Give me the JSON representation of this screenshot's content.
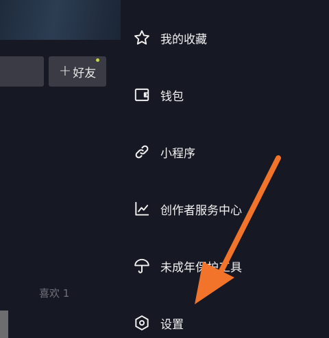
{
  "profile": {
    "add_friend_label": "好友",
    "add_friend_plus": "+",
    "likes_label": "喜欢 1"
  },
  "drawer": {
    "items": [
      {
        "label": "我的收藏",
        "icon": "star-icon"
      },
      {
        "label": "钱包",
        "icon": "wallet-icon"
      },
      {
        "label": "小程序",
        "icon": "link-icon"
      },
      {
        "label": "创作者服务中心",
        "icon": "chart-icon"
      },
      {
        "label": "未成年保护工具",
        "icon": "umbrella-icon"
      },
      {
        "label": "设置",
        "icon": "settings-icon"
      }
    ]
  },
  "colors": {
    "background": "#161823",
    "button_bg": "#3a3b44",
    "text_primary": "#f2f2f2",
    "text_muted": "#6f7079",
    "notification_dot": "#c8d64a",
    "annotation_arrow": "#f2742a"
  }
}
